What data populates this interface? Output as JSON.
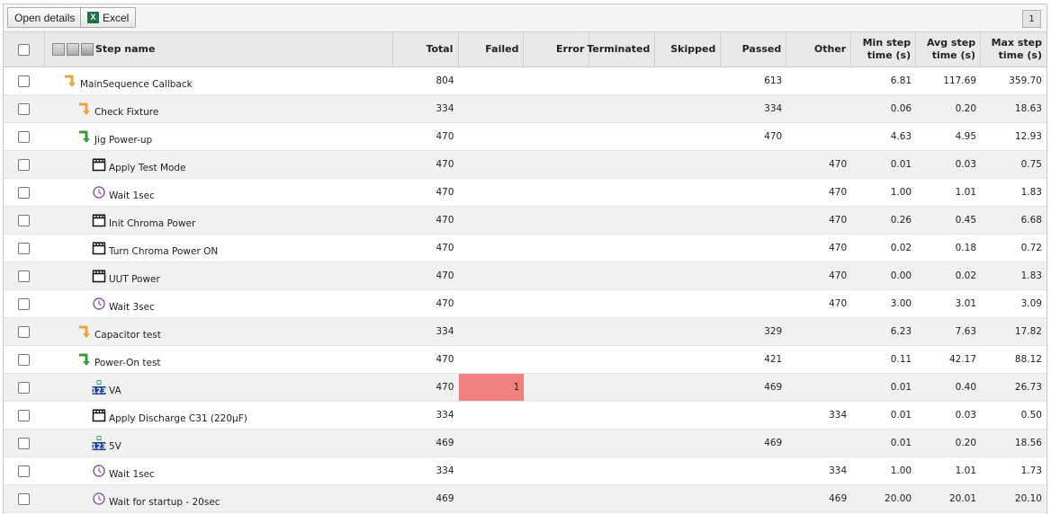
{
  "toolbar": {
    "open_details_label": "Open details",
    "excel_label": "Excel",
    "page_number": "1"
  },
  "columns": {
    "step_name": "Step name",
    "total": "Total",
    "failed": "Failed",
    "error": "Error",
    "terminated": "Terminated",
    "skipped": "Skipped",
    "passed": "Passed",
    "other": "Other",
    "min": "Min step time (s)",
    "avg": "Avg step time (s)",
    "max": "Max step time (s)"
  },
  "colors": {
    "orange_arrow": "#e8a33d",
    "green_arrow": "#2e9e3a",
    "clock_purple": "#8a5fa8",
    "numeric_blue": "#1a3fa0",
    "failed_highlight": "#f08080"
  },
  "rows": [
    {
      "name": "MainSequence Callback",
      "icon": "orange-arrow-icon",
      "indent": 1,
      "total": "804",
      "failed": "",
      "error": "",
      "terminated": "",
      "skipped": "",
      "passed": "613",
      "other": "",
      "min": "6.81",
      "avg": "117.69",
      "max": "359.70"
    },
    {
      "name": "Check Fixture",
      "icon": "orange-arrow-icon",
      "indent": 2,
      "total": "334",
      "failed": "",
      "error": "",
      "terminated": "",
      "skipped": "",
      "passed": "334",
      "other": "",
      "min": "0.06",
      "avg": "0.20",
      "max": "18.63"
    },
    {
      "name": "Jig Power-up",
      "icon": "green-arrow-icon",
      "indent": 2,
      "total": "470",
      "failed": "",
      "error": "",
      "terminated": "",
      "skipped": "",
      "passed": "470",
      "other": "",
      "min": "4.63",
      "avg": "4.95",
      "max": "12.93"
    },
    {
      "name": "Apply Test Mode",
      "icon": "action-icon",
      "indent": 3,
      "total": "470",
      "failed": "",
      "error": "",
      "terminated": "",
      "skipped": "",
      "passed": "",
      "other": "470",
      "min": "0.01",
      "avg": "0.03",
      "max": "0.75"
    },
    {
      "name": "Wait 1sec",
      "icon": "clock-icon",
      "indent": 3,
      "total": "470",
      "failed": "",
      "error": "",
      "terminated": "",
      "skipped": "",
      "passed": "",
      "other": "470",
      "min": "1.00",
      "avg": "1.01",
      "max": "1.83"
    },
    {
      "name": "Init Chroma Power",
      "icon": "action-icon",
      "indent": 3,
      "total": "470",
      "failed": "",
      "error": "",
      "terminated": "",
      "skipped": "",
      "passed": "",
      "other": "470",
      "min": "0.26",
      "avg": "0.45",
      "max": "6.68"
    },
    {
      "name": "Turn Chroma Power ON",
      "icon": "action-icon",
      "indent": 3,
      "total": "470",
      "failed": "",
      "error": "",
      "terminated": "",
      "skipped": "",
      "passed": "",
      "other": "470",
      "min": "0.02",
      "avg": "0.18",
      "max": "0.72"
    },
    {
      "name": "UUT Power",
      "icon": "action-icon",
      "indent": 3,
      "total": "470",
      "failed": "",
      "error": "",
      "terminated": "",
      "skipped": "",
      "passed": "",
      "other": "470",
      "min": "0.00",
      "avg": "0.02",
      "max": "1.83"
    },
    {
      "name": "Wait 3sec",
      "icon": "clock-icon",
      "indent": 3,
      "total": "470",
      "failed": "",
      "error": "",
      "terminated": "",
      "skipped": "",
      "passed": "",
      "other": "470",
      "min": "3.00",
      "avg": "3.01",
      "max": "3.09"
    },
    {
      "name": "Capacitor test",
      "icon": "orange-arrow-icon",
      "indent": 2,
      "total": "334",
      "failed": "",
      "error": "",
      "terminated": "",
      "skipped": "",
      "passed": "329",
      "other": "",
      "min": "6.23",
      "avg": "7.63",
      "max": "17.82"
    },
    {
      "name": "Power-On test",
      "icon": "green-arrow-icon",
      "indent": 2,
      "total": "470",
      "failed": "",
      "error": "",
      "terminated": "",
      "skipped": "",
      "passed": "421",
      "other": "",
      "min": "0.11",
      "avg": "42.17",
      "max": "88.12"
    },
    {
      "name": "VA",
      "icon": "numeric-limit-icon",
      "indent": 3,
      "total": "470",
      "failed": "1",
      "error": "",
      "terminated": "",
      "skipped": "",
      "passed": "469",
      "other": "",
      "min": "0.01",
      "avg": "0.40",
      "max": "26.73"
    },
    {
      "name": "Apply Discharge C31 (220µF)",
      "icon": "action-icon",
      "indent": 3,
      "total": "334",
      "failed": "",
      "error": "",
      "terminated": "",
      "skipped": "",
      "passed": "",
      "other": "334",
      "min": "0.01",
      "avg": "0.03",
      "max": "0.50"
    },
    {
      "name": "5V",
      "icon": "numeric-limit-icon",
      "indent": 3,
      "total": "469",
      "failed": "",
      "error": "",
      "terminated": "",
      "skipped": "",
      "passed": "469",
      "other": "",
      "min": "0.01",
      "avg": "0.20",
      "max": "18.56"
    },
    {
      "name": "Wait 1sec",
      "icon": "clock-icon",
      "indent": 3,
      "total": "334",
      "failed": "",
      "error": "",
      "terminated": "",
      "skipped": "",
      "passed": "",
      "other": "334",
      "min": "1.00",
      "avg": "1.01",
      "max": "1.73"
    },
    {
      "name": "Wait for startup - 20sec",
      "icon": "clock-icon",
      "indent": 3,
      "total": "469",
      "failed": "",
      "error": "",
      "terminated": "",
      "skipped": "",
      "passed": "",
      "other": "469",
      "min": "20.00",
      "avg": "20.01",
      "max": "20.10"
    }
  ]
}
